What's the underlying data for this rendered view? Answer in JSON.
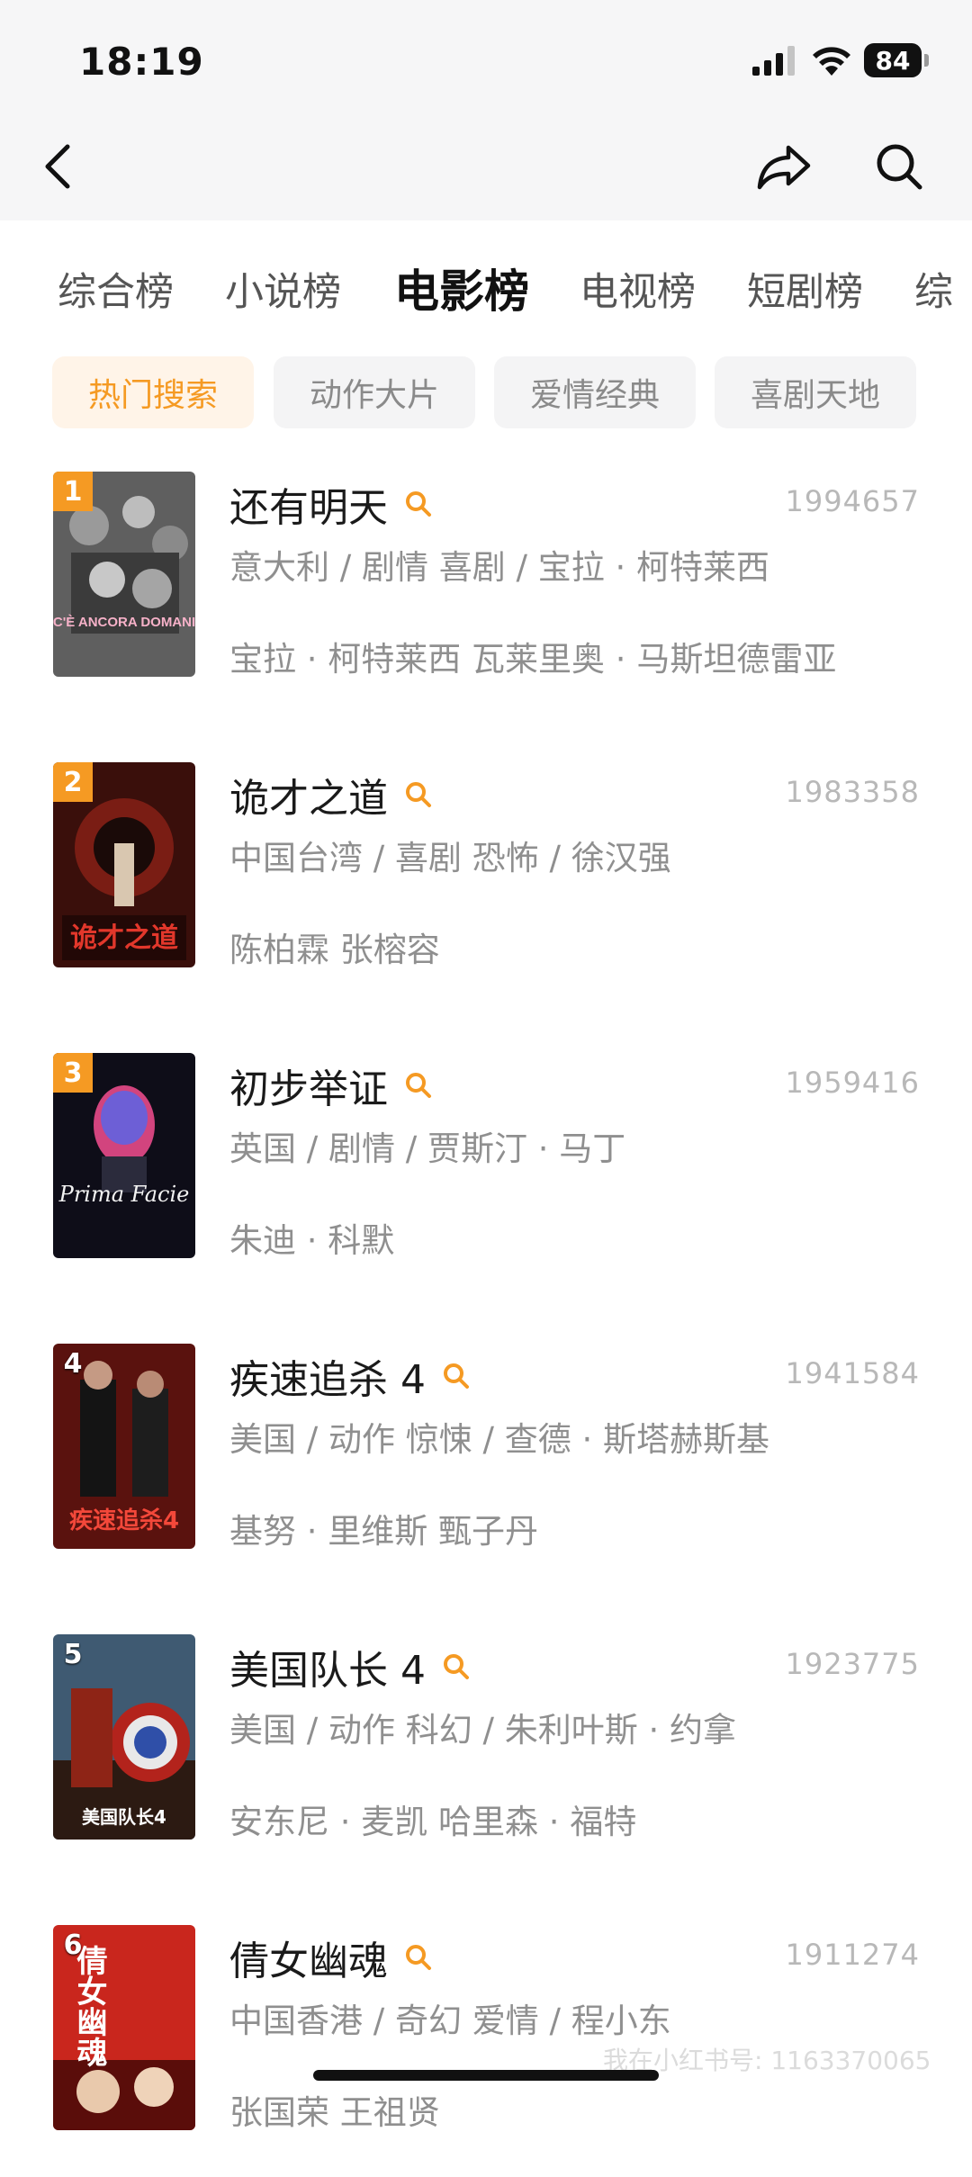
{
  "status_bar": {
    "time": "18:19",
    "battery": "84"
  },
  "nav": {
    "back_icon": "chevron-left-icon",
    "share_icon": "share-arrow-icon",
    "search_icon": "search-icon"
  },
  "category_tabs": [
    {
      "label": "综合榜",
      "active": false
    },
    {
      "label": "小说榜",
      "active": false
    },
    {
      "label": "电影榜",
      "active": true
    },
    {
      "label": "电视榜",
      "active": false
    },
    {
      "label": "短剧榜",
      "active": false
    },
    {
      "label": "综",
      "active": false
    }
  ],
  "chips": [
    {
      "label": "热门搜索",
      "active": true
    },
    {
      "label": "动作大片",
      "active": false
    },
    {
      "label": "爱情经典",
      "active": false
    },
    {
      "label": "喜剧天地",
      "active": false
    }
  ],
  "colors": {
    "accent": "#f59a23",
    "chip_active_bg": "#fff4e8"
  },
  "movies": [
    {
      "rank": "1",
      "title": "还有明天",
      "heat": "1994657",
      "meta": "意大利 / 剧情 喜剧 / 宝拉 · 柯特莱西",
      "cast": "宝拉 · 柯特莱西 瓦莱里奥 · 马斯坦德雷亚",
      "poster_caption": "C'È ANCORA DOMANI",
      "poster_colors": [
        "#6e6e6e",
        "#2b2b2b"
      ]
    },
    {
      "rank": "2",
      "title": "诡才之道",
      "heat": "1983358",
      "meta": "中国台湾 / 喜剧 恐怖 / 徐汉强",
      "cast": "陈柏霖 张榕容",
      "poster_caption": "诡才之道",
      "poster_colors": [
        "#7a1d14",
        "#1e0b08"
      ]
    },
    {
      "rank": "3",
      "title": "初步举证",
      "heat": "1959416",
      "meta": "英国 / 剧情 / 贾斯汀 · 马丁",
      "cast": "朱迪 · 科默",
      "poster_caption": "Prima Facie",
      "poster_colors": [
        "#3a1f4a",
        "#0d0d14"
      ]
    },
    {
      "rank": "4",
      "title": "疾速追杀 4",
      "heat": "1941584",
      "meta": "美国 / 动作 惊悚 / 查德 · 斯塔赫斯基",
      "cast": "基努 · 里维斯 甄子丹",
      "poster_caption": "疾速追杀4",
      "poster_colors": [
        "#8a1d17",
        "#2a0705"
      ]
    },
    {
      "rank": "5",
      "title": "美国队长 4",
      "heat": "1923775",
      "meta": "美国 / 动作 科幻 / 朱利叶斯 · 约拿",
      "cast": "安东尼 · 麦凯 哈里森 · 福特",
      "poster_caption": "美国队长4",
      "poster_colors": [
        "#4b6c88",
        "#2a1b14"
      ]
    },
    {
      "rank": "6",
      "title": "倩女幽魂",
      "heat": "1911274",
      "meta": "中国香港 / 奇幻 爱情 / 程小东",
      "cast": "张国荣 王祖贤",
      "poster_caption": "倩女幽魂",
      "poster_colors": [
        "#c9261d",
        "#5a0d0a"
      ]
    }
  ],
  "watermark": "我在小红书号: 1163370065"
}
